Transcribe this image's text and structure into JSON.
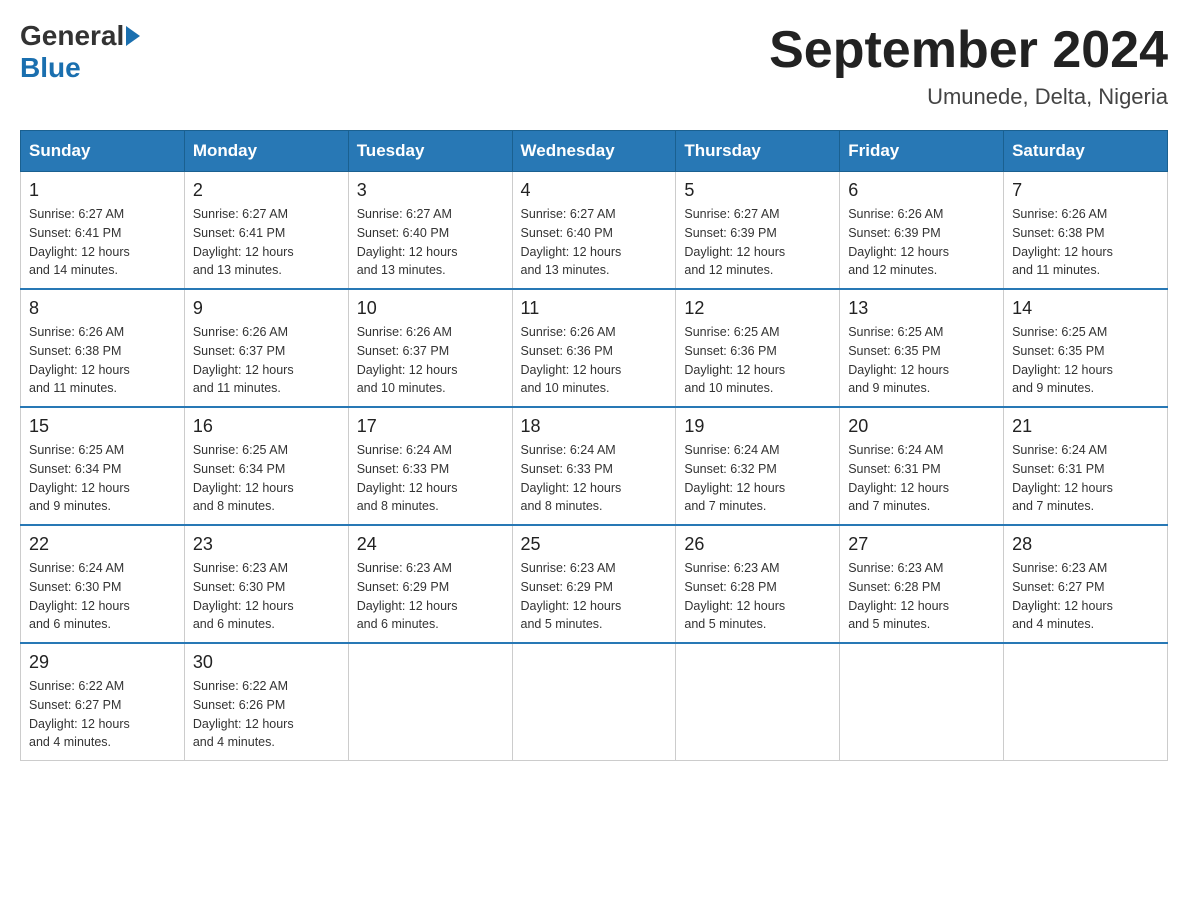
{
  "logo": {
    "general": "General",
    "blue": "Blue"
  },
  "title": "September 2024",
  "subtitle": "Umunede, Delta, Nigeria",
  "days_of_week": [
    "Sunday",
    "Monday",
    "Tuesday",
    "Wednesday",
    "Thursday",
    "Friday",
    "Saturday"
  ],
  "weeks": [
    [
      {
        "day": "1",
        "sunrise": "6:27 AM",
        "sunset": "6:41 PM",
        "daylight": "12 hours and 14 minutes."
      },
      {
        "day": "2",
        "sunrise": "6:27 AM",
        "sunset": "6:41 PM",
        "daylight": "12 hours and 13 minutes."
      },
      {
        "day": "3",
        "sunrise": "6:27 AM",
        "sunset": "6:40 PM",
        "daylight": "12 hours and 13 minutes."
      },
      {
        "day": "4",
        "sunrise": "6:27 AM",
        "sunset": "6:40 PM",
        "daylight": "12 hours and 13 minutes."
      },
      {
        "day": "5",
        "sunrise": "6:27 AM",
        "sunset": "6:39 PM",
        "daylight": "12 hours and 12 minutes."
      },
      {
        "day": "6",
        "sunrise": "6:26 AM",
        "sunset": "6:39 PM",
        "daylight": "12 hours and 12 minutes."
      },
      {
        "day": "7",
        "sunrise": "6:26 AM",
        "sunset": "6:38 PM",
        "daylight": "12 hours and 11 minutes."
      }
    ],
    [
      {
        "day": "8",
        "sunrise": "6:26 AM",
        "sunset": "6:38 PM",
        "daylight": "12 hours and 11 minutes."
      },
      {
        "day": "9",
        "sunrise": "6:26 AM",
        "sunset": "6:37 PM",
        "daylight": "12 hours and 11 minutes."
      },
      {
        "day": "10",
        "sunrise": "6:26 AM",
        "sunset": "6:37 PM",
        "daylight": "12 hours and 10 minutes."
      },
      {
        "day": "11",
        "sunrise": "6:26 AM",
        "sunset": "6:36 PM",
        "daylight": "12 hours and 10 minutes."
      },
      {
        "day": "12",
        "sunrise": "6:25 AM",
        "sunset": "6:36 PM",
        "daylight": "12 hours and 10 minutes."
      },
      {
        "day": "13",
        "sunrise": "6:25 AM",
        "sunset": "6:35 PM",
        "daylight": "12 hours and 9 minutes."
      },
      {
        "day": "14",
        "sunrise": "6:25 AM",
        "sunset": "6:35 PM",
        "daylight": "12 hours and 9 minutes."
      }
    ],
    [
      {
        "day": "15",
        "sunrise": "6:25 AM",
        "sunset": "6:34 PM",
        "daylight": "12 hours and 9 minutes."
      },
      {
        "day": "16",
        "sunrise": "6:25 AM",
        "sunset": "6:34 PM",
        "daylight": "12 hours and 8 minutes."
      },
      {
        "day": "17",
        "sunrise": "6:24 AM",
        "sunset": "6:33 PM",
        "daylight": "12 hours and 8 minutes."
      },
      {
        "day": "18",
        "sunrise": "6:24 AM",
        "sunset": "6:33 PM",
        "daylight": "12 hours and 8 minutes."
      },
      {
        "day": "19",
        "sunrise": "6:24 AM",
        "sunset": "6:32 PM",
        "daylight": "12 hours and 7 minutes."
      },
      {
        "day": "20",
        "sunrise": "6:24 AM",
        "sunset": "6:31 PM",
        "daylight": "12 hours and 7 minutes."
      },
      {
        "day": "21",
        "sunrise": "6:24 AM",
        "sunset": "6:31 PM",
        "daylight": "12 hours and 7 minutes."
      }
    ],
    [
      {
        "day": "22",
        "sunrise": "6:24 AM",
        "sunset": "6:30 PM",
        "daylight": "12 hours and 6 minutes."
      },
      {
        "day": "23",
        "sunrise": "6:23 AM",
        "sunset": "6:30 PM",
        "daylight": "12 hours and 6 minutes."
      },
      {
        "day": "24",
        "sunrise": "6:23 AM",
        "sunset": "6:29 PM",
        "daylight": "12 hours and 6 minutes."
      },
      {
        "day": "25",
        "sunrise": "6:23 AM",
        "sunset": "6:29 PM",
        "daylight": "12 hours and 5 minutes."
      },
      {
        "day": "26",
        "sunrise": "6:23 AM",
        "sunset": "6:28 PM",
        "daylight": "12 hours and 5 minutes."
      },
      {
        "day": "27",
        "sunrise": "6:23 AM",
        "sunset": "6:28 PM",
        "daylight": "12 hours and 5 minutes."
      },
      {
        "day": "28",
        "sunrise": "6:23 AM",
        "sunset": "6:27 PM",
        "daylight": "12 hours and 4 minutes."
      }
    ],
    [
      {
        "day": "29",
        "sunrise": "6:22 AM",
        "sunset": "6:27 PM",
        "daylight": "12 hours and 4 minutes."
      },
      {
        "day": "30",
        "sunrise": "6:22 AM",
        "sunset": "6:26 PM",
        "daylight": "12 hours and 4 minutes."
      },
      null,
      null,
      null,
      null,
      null
    ]
  ],
  "labels": {
    "sunrise": "Sunrise:",
    "sunset": "Sunset:",
    "daylight": "Daylight:"
  }
}
